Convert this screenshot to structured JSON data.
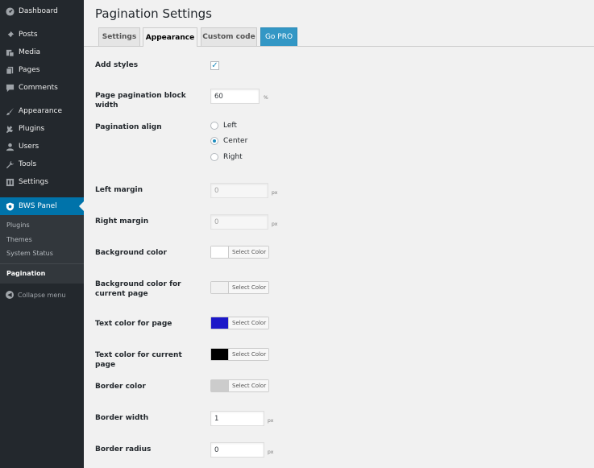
{
  "sidebar": {
    "menu": [
      {
        "label": "Dashboard",
        "icon": "dashboard-icon"
      },
      {
        "label": "Posts",
        "icon": "pin-icon"
      },
      {
        "label": "Media",
        "icon": "media-icon"
      },
      {
        "label": "Pages",
        "icon": "pages-icon"
      },
      {
        "label": "Comments",
        "icon": "comments-icon"
      },
      {
        "label": "Appearance",
        "icon": "brush-icon"
      },
      {
        "label": "Plugins",
        "icon": "plug-icon"
      },
      {
        "label": "Users",
        "icon": "user-icon"
      },
      {
        "label": "Tools",
        "icon": "wrench-icon"
      },
      {
        "label": "Settings",
        "icon": "settings-icon"
      },
      {
        "label": "BWS Panel",
        "icon": "bws-icon"
      }
    ],
    "submenu": [
      "Plugins",
      "Themes",
      "System Status"
    ],
    "current": "Pagination",
    "collapse": "Collapse menu"
  },
  "header": {
    "title": "Pagination Settings"
  },
  "tabs": [
    {
      "label": "Settings"
    },
    {
      "label": "Appearance"
    },
    {
      "label": "Custom code"
    },
    {
      "label": "Go PRO"
    }
  ],
  "form": {
    "add_styles": {
      "label": "Add styles",
      "checked": true
    },
    "block_width": {
      "label": "Page pagination block width",
      "value": "60",
      "unit": "%"
    },
    "align": {
      "label": "Pagination align",
      "options": [
        "Left",
        "Center",
        "Right"
      ],
      "selected": "Center"
    },
    "left_margin": {
      "label": "Left margin",
      "value": "0",
      "unit": "px"
    },
    "right_margin": {
      "label": "Right margin",
      "value": "0",
      "unit": "px"
    },
    "bg_color": {
      "label": "Background color",
      "color": "#ffffff"
    },
    "bg_color_current": {
      "label": "Background color for current page",
      "color": "#f1f1f1"
    },
    "text_color": {
      "label": "Text color for page",
      "color": "#1c18c8"
    },
    "text_color_current": {
      "label": "Text color for current page",
      "color": "#000000"
    },
    "border_color": {
      "label": "Border color",
      "color": "#cccccc"
    },
    "border_width": {
      "label": "Border width",
      "value": "1",
      "unit": "px"
    },
    "border_radius": {
      "label": "Border radius",
      "value": "0",
      "unit": "px"
    },
    "select_color_label": "Select Color"
  },
  "colors": {
    "accent": "#0073aa",
    "sidebar_bg": "#23282d",
    "pro_tab": "#3397c5"
  }
}
